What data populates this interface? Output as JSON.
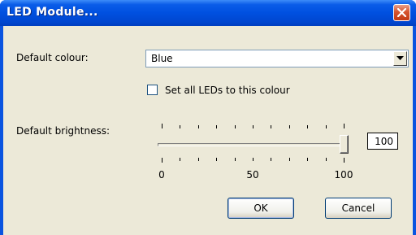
{
  "dialog": {
    "title": "LED Module...",
    "close_icon": "close-x-icon"
  },
  "colour": {
    "label": "Default colour:",
    "selected": "Blue",
    "dropdown_icon": "chevron-down-icon"
  },
  "set_all": {
    "label": "Set all LEDs to this colour",
    "checked": false
  },
  "brightness": {
    "label": "Default brightness:",
    "value": "100",
    "min": 0,
    "max": 100,
    "tick_labels": [
      "0",
      "50",
      "100"
    ]
  },
  "buttons": {
    "ok": "OK",
    "cancel": "Cancel"
  },
  "colors": {
    "titlebar": "#0050e0",
    "dialog_bg": "#ece9d8",
    "close_button": "#d6542e"
  }
}
